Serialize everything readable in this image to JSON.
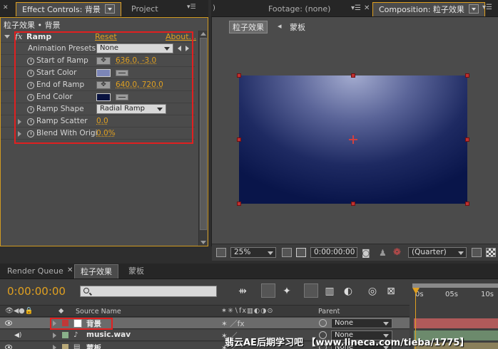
{
  "left_tabs": {
    "effect_controls": "Effect Controls: 背景",
    "project": "Project"
  },
  "right_tabs": {
    "footage": "Footage: (none)",
    "composition": "Composition: 粒子效果"
  },
  "effect_controls": {
    "breadcrumb": "粒子效果 • 背景",
    "effect_name": "Ramp",
    "reset_label": "Reset",
    "about_label": "About...",
    "presets_label": "Animation Presets:",
    "presets_value": "None",
    "start_of_ramp_label": "Start of Ramp",
    "start_of_ramp_value": "636.0, -3.0",
    "start_color_label": "Start Color",
    "start_color": "#7c86b8",
    "end_of_ramp_label": "End of Ramp",
    "end_of_ramp_value": "640.0, 720.0",
    "end_color_label": "End Color",
    "end_color": "#08123f",
    "ramp_shape_label": "Ramp Shape",
    "ramp_shape_value": "Radial Ramp",
    "ramp_scatter_label": "Ramp Scatter",
    "ramp_scatter_value": "0.0",
    "blend_label": "Blend With Origi",
    "blend_value": "0.0%"
  },
  "composition": {
    "crumb_active": "粒子效果",
    "crumb_other": "蒙板",
    "zoom": "25%",
    "timecode": "0:00:00:00",
    "resolution": "(Quarter)"
  },
  "timeline": {
    "tabs": {
      "render_queue": "Render Queue",
      "comp1": "粒子效果",
      "comp2": "蒙板"
    },
    "timecode": "0:00:00:00",
    "ruler": [
      "0s",
      "05s",
      "10s"
    ],
    "columns": {
      "source_name": "Source Name",
      "parent": "Parent"
    },
    "layers": [
      {
        "name": "背景",
        "parent": "None",
        "label_color": "#c03838",
        "bar_color": "#b05a5a"
      },
      {
        "name": "music.wav",
        "parent": "None",
        "label_color": "#8ab08a",
        "bar_color": "#6c8a6c"
      },
      {
        "name": "蒙板",
        "parent": "None",
        "label_color": "#b8a878",
        "bar_color": "#8a7f5a"
      }
    ]
  },
  "watermark": "翡云AE后期学习吧 【www.lineca.com/tieba/1775】",
  "accent": "#e0a020"
}
